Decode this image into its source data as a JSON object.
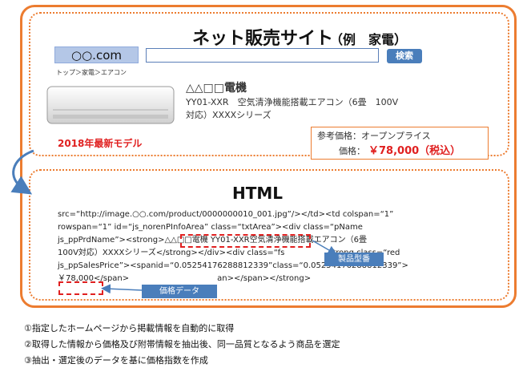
{
  "site": {
    "title": "ネット販売サイト",
    "subtitle": "（例　家電）",
    "domain": "○○.com",
    "search_button": "検索",
    "breadcrumb": "トップ＞家電＞エアコン"
  },
  "product": {
    "brand": "△△□□電機",
    "model": "YY01-XXR　空気清浄機能搭載エアコン（6畳　100V対応）XXXXシリーズ",
    "latest_label": "2018年最新モデル",
    "reference_price": "参考価格：オープンプライス",
    "price_label": "価格：",
    "price_value": "￥78,000（税込）"
  },
  "html_panel": {
    "title": "HTML",
    "code_lines": [
      "src=“http://image.○○.com/product/0000000010_001.jpg”/></td><td colspan=“1”",
      "rowspan=“1” id=“js_norenPInfoArea” class=“txtArea”><div class=“pName",
      "js_ppPrdName”><strong>△△□□電機 YY01-XXR空気清浄機能搭載エアコン（6畳",
      "100V対応）XXXXシリーズ</strong></div><div class=“fs　　　　　　trong class=“red",
      "js_ppSalesPrice”><spanid=“0.05254176288812339”class=“0.05254176288812339”>",
      "￥78,000</span>　　　　　　　　　　　an></span></strong>"
    ],
    "tag_model": "製品型番",
    "tag_price": "価格データ"
  },
  "notes": [
    "①指定したホームページから掲載情報を自動的に取得",
    "②取得した情報から価格及び附帯情報を抽出後、同一品質となるよう商品を選定",
    "③抽出・選定後のデータを基に価格指数を作成"
  ],
  "colors": {
    "frame": "#ec7c30",
    "accent_blue": "#4a7ebb",
    "highlight_red": "#e02020"
  }
}
